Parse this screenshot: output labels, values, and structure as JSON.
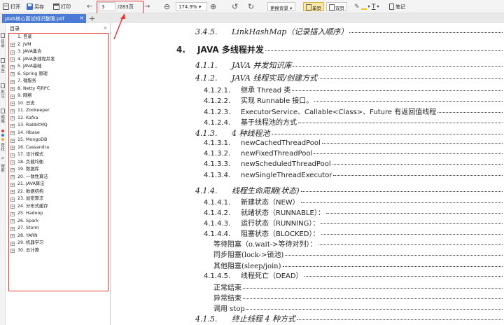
{
  "toolbar": {
    "open_label": "打开",
    "save_as_label": "另存",
    "print_label": "打印",
    "page_current": "3",
    "page_total": "/283页",
    "zoom": "174.9%",
    "background_label": "更换背景",
    "single_page_label": "单页",
    "double_page_label": "双页",
    "notes_label": "笔记"
  },
  "tab": {
    "title": "JAVA核心面试知识整理.pdf"
  },
  "rail": {
    "items": [
      "目录",
      "书签",
      "批注",
      "缩略",
      "查找",
      "搜索"
    ]
  },
  "outline": {
    "title": "目录",
    "items": [
      "1. 目录",
      "2. JVM",
      "3. JAVA集合",
      "4. JAVA多线程并发",
      "5. JAVA基础",
      "6. Spring 原理",
      "7. 微服务",
      "8. Netty 与RPC",
      "9. 网络",
      "10. 日志",
      "11. Zookeeper",
      "12. Kafka",
      "13. RabbitMQ",
      "14. Hbase",
      "15. MongoDB",
      "16. Cassandra",
      "17. 设计模式",
      "18. 负载均衡",
      "19. 数据库",
      "20. 一致性算法",
      "21. JAVA算法",
      "22. 数据结构",
      "23. 加密算法",
      "24. 分布式缓存",
      "25. Hadoop",
      "26. Spark",
      "27. Storm",
      "28. YARN",
      "29. 机器学习",
      "30. 云计算"
    ]
  },
  "doc": {
    "entries": [
      {
        "num": "3.4.5.",
        "title": "LinkHashMap（记录插入顺序）",
        "level": 2
      },
      {
        "num": "4.",
        "title": "JAVA 多线程并发",
        "level": 1
      },
      {
        "num": "4.1.1.",
        "title": "JAVA 并发知识库",
        "level": 2
      },
      {
        "num": "4.1.2.",
        "title": "JAVA 线程实现/创建方式",
        "level": 2
      },
      {
        "num": "4.1.2.1.",
        "title": "继承 Thread 类",
        "level": 3
      },
      {
        "num": "4.1.2.2.",
        "title": "实现 Runnable 接口。",
        "level": 3
      },
      {
        "num": "4.1.2.3.",
        "title": "ExecutorService、Callable<Class>、Future 有返回值线程",
        "level": 3
      },
      {
        "num": "4.1.2.4.",
        "title": "基于线程池的方式",
        "level": 3
      },
      {
        "num": "4.1.3.",
        "title": "4 种线程池",
        "level": 2
      },
      {
        "num": "4.1.3.1.",
        "title": "newCachedThreadPool",
        "level": 3
      },
      {
        "num": "4.1.3.2.",
        "title": "newFixedThreadPool",
        "level": 3
      },
      {
        "num": "4.1.3.3.",
        "title": "newScheduledThreadPool",
        "level": 3
      },
      {
        "num": "4.1.3.4.",
        "title": "newSingleThreadExecutor",
        "level": 3
      },
      {
        "num": "4.1.4.",
        "title": "线程生命周期(状态)",
        "level": 2
      },
      {
        "num": "4.1.4.1.",
        "title": "新建状态（NEW）",
        "level": 3
      },
      {
        "num": "4.1.4.2.",
        "title": "就绪状态（RUNNABLE）：",
        "level": 3
      },
      {
        "num": "4.1.4.3.",
        "title": "运行状态（RUNNING）：",
        "level": 3
      },
      {
        "num": "4.1.4.4.",
        "title": "阻塞状态（BLOCKED）：",
        "level": 3
      },
      {
        "num": "",
        "title": "等待阻塞（o.wait->等待对列）：",
        "level": 4
      },
      {
        "num": "",
        "title": "同步阻塞(lock->锁池)",
        "level": 4
      },
      {
        "num": "",
        "title": "其他阻塞(sleep/join)",
        "level": 4
      },
      {
        "num": "4.1.4.5.",
        "title": "线程死亡（DEAD）",
        "level": 3
      },
      {
        "num": "",
        "title": "正常结束",
        "level": 4
      },
      {
        "num": "",
        "title": "异常结束",
        "level": 4
      },
      {
        "num": "",
        "title": "调用 stop",
        "level": 4
      },
      {
        "num": "4.1.5.",
        "title": "终止线程 4 种方式",
        "level": 2
      }
    ]
  }
}
